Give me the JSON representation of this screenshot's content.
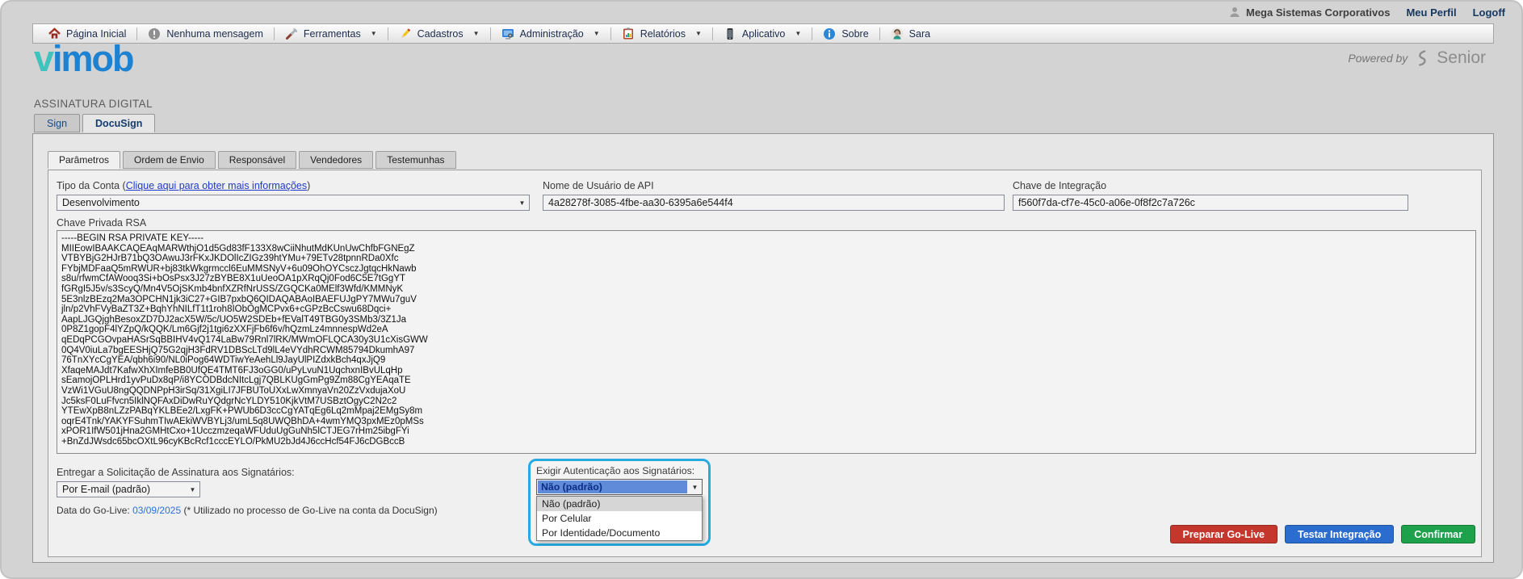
{
  "topbar": {
    "company": "Mega Sistemas Corporativos",
    "profile": "Meu Perfil",
    "logoff": "Logoff"
  },
  "toolbar": {
    "items": [
      {
        "label": "Página Inicial"
      },
      {
        "label": "Nenhuma mensagem"
      },
      {
        "label": "Ferramentas"
      },
      {
        "label": "Cadastros"
      },
      {
        "label": "Administração"
      },
      {
        "label": "Relatórios"
      },
      {
        "label": "Aplicativo"
      },
      {
        "label": "Sobre"
      },
      {
        "label": "Sara"
      }
    ]
  },
  "brand": {
    "logo_teal": "v",
    "logo_blue": "imob",
    "powered_by": "Powered by",
    "vendor": "Senior"
  },
  "section": {
    "title": "ASSINATURA DIGITAL"
  },
  "tabs": {
    "sign": "Sign",
    "docusign": "DocuSign"
  },
  "subtabs": {
    "parametros": "Parâmetros",
    "ordem": "Ordem de Envio",
    "responsavel": "Responsável",
    "vendedores": "Vendedores",
    "testemunhas": "Testemunhas"
  },
  "form": {
    "account_type": {
      "label_pre": "Tipo da Conta (",
      "link": "Clique aqui para obter mais informações",
      "label_post": ")",
      "value": "Desenvolvimento"
    },
    "api_user": {
      "label": "Nome de Usuário de API",
      "value": "4a28278f-3085-4fbe-aa30-6395a6e544f4"
    },
    "integration_key": {
      "label": "Chave de Integração",
      "value": "f560f7da-cf7e-45c0-a06e-0f8f2c7a726c"
    },
    "rsa": {
      "label": "Chave Privada RSA",
      "value": "-----BEGIN RSA PRIVATE KEY-----\nMIIEowIBAAKCAQEAqMARWthjO1d5Gd83fF133X8wCiiNhutMdKUnUwChfbFGNEgZ\nVTBYBjG2HJrB71bQ3OAwuJ3rFKxJKDOlIcZIGz39htYMu+79ETv28tpnnRDa0Xfc\nFYbjMDFaaQ5mRWUR+bj83tkWkgrmccl6EuMMSNyV+6u09OhOYCsczJgtqcHkNawb\ns8u/rfwmCfAWooq3Si+bOsPsx3J27zBYBE8X1uUeoOA1pXRqQj0Fod6C5E7tGgYT\nfGRgI5J5v/s3ScyQ/Mn4V5OjSKmb4bnfXZRfNrUSS/ZGQCKa0MElf3Wfd/KMMNyK\n5E3nlzBEzq2Ma3OPCHN1jk3iC27+GIB7pxbQ6QIDAQABAoIBAEFUJgPY7MWu7guV\njln/p2VhFVyBaZT3Z+BqhYhNILfT1t1roh8IObOgMCPvx6+cGPzBcCswu68Dqci+\nAapLJGQjghBesoxZD7DJ2acX5W/5c/UO5W2SDEb+fEValT49TBG0y3SMb3/3Z1Ja\n0P8Z1gopF4lYZpQ/kQQK/Lm6Gjf2j1tgi6zXXFjFb6f6v/hQzmLz4mnnespWd2eA\nqEDqPCGOvpaHASrSqBBIHV4vQ174LaBw79Rnl7lRK/MWmOFLQCA30y3U1cXisGWW\n0Q4V0iuLa7bgEESHjQ75G2qjH3FdRV1DBScLTd9lL4eVYdhRCWM85794DkumhA97\n76TnXYcCgYEA/qbh6i90/NL0iPog64WDTiwYeAehLl9JayUlPIZdxkBch4qxJjQ9\nXfaqeMAJdt7KafwXhXImfeBB0UfQE4TMT6FJ3oGG0/uPyLvuN1UqchxnIBvULqHp\nsEamojOPLHrd1yvPuDx8qP/i8YCODBdcNItcLgj7QBLKUgGmPg9Zm88CgYEAqaTE\nVzWi1VGuU8ngQQDNPpH3irSq/31XgiLI7JFBUToUXxLwXmnyaVn20ZzVxdujaXoU\nJc5ksF0LuFfvcn5IklNQFAxDiDwRuYQdgrNcYLDY510KjkVtM7USBztOgyC2N2c2\nYTEwXpB8nLZzPABqYKLBEe2/LxgFK+PWUb6D3ccCgYATqEg6Lq2mMpaj2EMgSy8m\noqrE4Tnk/YAKYFSuhmTIwAEkiWVBYLj3/umL5q8UWQBhDA+4wmYMQ3pxMEz0pMSs\nxPOR1IfW501jHna2GMHtCxo+1UcczmzeqaWFUduUgGuNh5lCTJEG7rHm25ibgFYi\n+BnZdJWsdc65bcOXtL96cyKBcRcf1cccEYLO/PkMU2bJd4J6ccHcf54FJ6cDGBccB"
    }
  },
  "delivery": {
    "label": "Entregar a Solicitação de Assinatura aos Signatários:",
    "value": "Por E-mail (padrão)"
  },
  "golive": {
    "label": "Data do Go-Live:",
    "date": "03/09/2025",
    "note": "(* Utilizado no processo de Go-Live na conta da DocuSign)"
  },
  "auth": {
    "label": "Exigir Autenticação aos Signatários:",
    "value": "Não (padrão)",
    "options": [
      "Não (padrão)",
      "Por Celular",
      "Por Identidade/Documento"
    ]
  },
  "actions": {
    "prepare": "Preparar Go-Live",
    "test": "Testar Integração",
    "confirm": "Confirmar"
  },
  "colors": {
    "accent-cyan": "#27aae1",
    "btn-red": "#c5372c",
    "btn-blue": "#2a6dce",
    "btn-green": "#1ea14b",
    "link-blue": "#2038c8",
    "logo-teal": "#3fc3bd",
    "logo-blue": "#1d82d2",
    "selection-blue": "#5f8bd9",
    "selection-text": "#0b2d87",
    "date-blue": "#2f6fd0",
    "nav-navy": "#17375e"
  }
}
